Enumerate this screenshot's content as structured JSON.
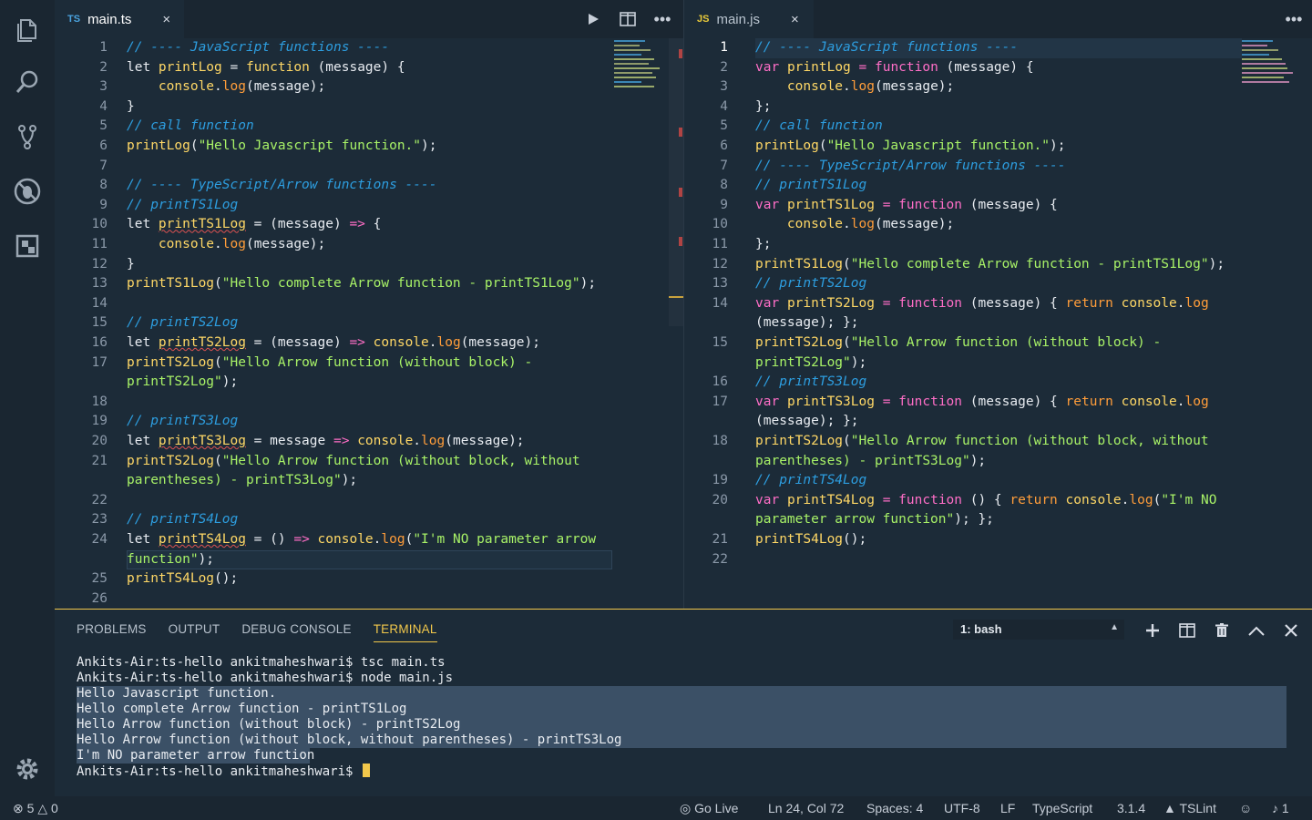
{
  "activity": {
    "icons": [
      "files-icon",
      "search-icon",
      "source-control-icon",
      "debug-icon",
      "extensions-icon",
      "settings-gear-icon"
    ]
  },
  "left_editor": {
    "tab": {
      "badge": "TS",
      "name": "main.ts",
      "close": "×"
    },
    "actions": [
      "run-icon",
      "split-editor-icon",
      "more-icon"
    ],
    "line_numbers": [
      "1",
      "2",
      "3",
      "4",
      "5",
      "6",
      "7",
      "8",
      "9",
      "10",
      "11",
      "12",
      "13",
      "14",
      "15",
      "16",
      "17",
      "",
      "18",
      "19",
      "20",
      "21",
      "",
      "22",
      "23",
      "24",
      "",
      "25",
      "26"
    ]
  },
  "right_editor": {
    "tab": {
      "badge": "JS",
      "name": "main.js",
      "close": "×"
    },
    "actions": [
      "more-icon"
    ],
    "line_numbers": [
      "1",
      "2",
      "3",
      "4",
      "5",
      "6",
      "7",
      "8",
      "9",
      "10",
      "11",
      "12",
      "13",
      "14",
      "",
      "15",
      "",
      "16",
      "17",
      "",
      "18",
      "",
      "19",
      "20",
      "",
      "21",
      "22"
    ]
  },
  "panel": {
    "tabs": [
      "PROBLEMS",
      "OUTPUT",
      "DEBUG CONSOLE",
      "TERMINAL"
    ],
    "active_tab": "TERMINAL",
    "terminal_select": "1: bash",
    "actions": [
      "new-terminal-icon",
      "split-terminal-icon",
      "trash-icon",
      "maximize-icon",
      "close-icon"
    ],
    "terminal_lines": [
      "Ankits-Air:ts-hello ankitmaheshwari$ tsc main.ts",
      "Ankits-Air:ts-hello ankitmaheshwari$ node main.js",
      "Hello Javascript function.",
      "Hello complete Arrow function - printTS1Log",
      "Hello Arrow function (without block) - printTS2Log",
      "Hello Arrow function (without block, without parentheses) - printTS3Log",
      "I'm NO parameter arrow function",
      "Ankits-Air:ts-hello ankitmaheshwari$ "
    ]
  },
  "status": {
    "errors": "5",
    "warnings": "0",
    "go_live": "Go Live",
    "position": "Ln 24, Col 72",
    "spaces": "Spaces: 4",
    "encoding": "UTF-8",
    "eol": "LF",
    "language": "TypeScript",
    "ts_version": "3.1.4",
    "lint": "TSLint",
    "notifications": "1"
  },
  "colors": {
    "accent": "#f2c84b",
    "comment": "#2d9ee0",
    "string": "#a8f267",
    "function": "#ffd866",
    "keyword_pink": "#ff6ec7",
    "property": "#ff9d3a"
  }
}
